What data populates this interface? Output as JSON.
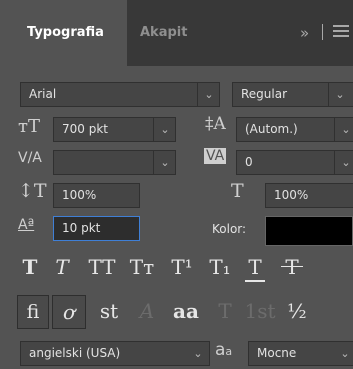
{
  "tabs": {
    "active": "Typografia",
    "inactive": "Akapit",
    "overflow": "»"
  },
  "font": {
    "family": "Arial",
    "style": "Regular"
  },
  "size": {
    "font_size": "700 pkt",
    "leading": "(Autom.)",
    "kerning": "",
    "tracking": "0"
  },
  "scale": {
    "vertical": "100%",
    "horizontal": "100%"
  },
  "baseline": {
    "shift": "10 pkt",
    "color_label": "Kolor:",
    "color": "#000000"
  },
  "style_buttons": [
    "T",
    "T",
    "TT",
    "Tт",
    "T¹",
    "T₁",
    "T",
    "T"
  ],
  "opentype_buttons": [
    "fi",
    "ơ",
    "st",
    "A",
    "aa",
    "T",
    "1st",
    "½"
  ],
  "language": {
    "value": "angielski (USA)",
    "aa": "a",
    "aa_sub": "a",
    "antialias": "Mocne"
  }
}
